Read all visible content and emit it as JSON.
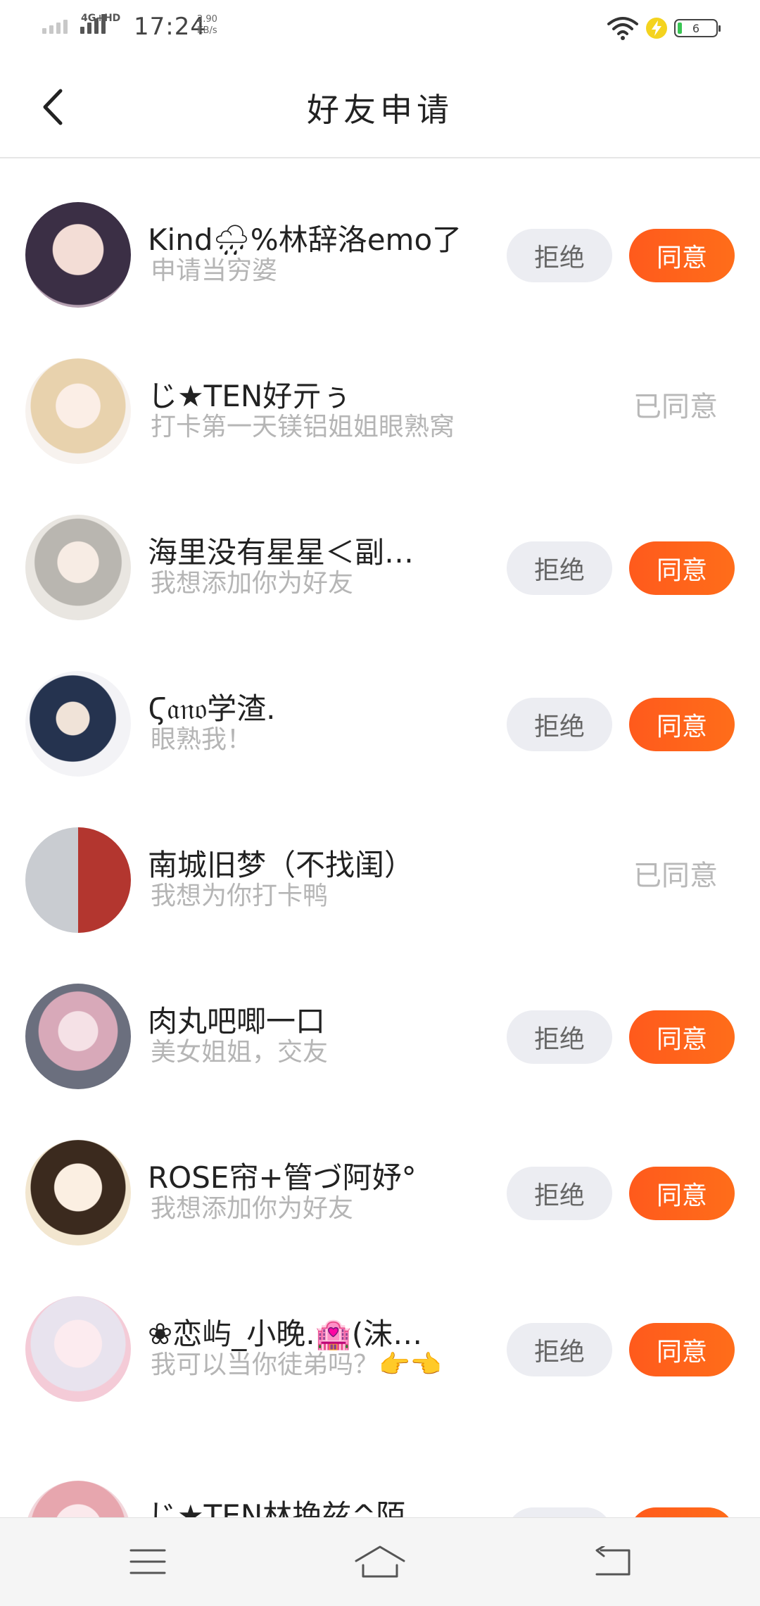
{
  "status_bar": {
    "network": "4G+HD",
    "time": "17:24",
    "speed_value": "2.90",
    "speed_unit": "KB/s",
    "battery_level": "6"
  },
  "header": {
    "title": "好友申请"
  },
  "buttons": {
    "reject": "拒绝",
    "agree": "同意"
  },
  "requests": [
    {
      "name": "Kind🌧%林辞洛emo了",
      "message": "申请当穷婆",
      "status": "pending"
    },
    {
      "name": "じ★TEN好亓ぅ",
      "message": "打卡第一天镁铝姐姐眼熟窝",
      "status": "agreed",
      "status_label": "已同意"
    },
    {
      "name": "海里没有星星＜副…",
      "message": "我想添加你为好友",
      "status": "pending"
    },
    {
      "name": "Ϛ𝔞𝔫𝔬学渣.",
      "message": "眼熟我！",
      "status": "pending"
    },
    {
      "name": "南城旧梦（不找闺）",
      "message": "我想为你打卡鸭",
      "status": "agreed",
      "status_label": "已同意"
    },
    {
      "name": "肉丸吧唧一口",
      "message": "美女姐姐，交友",
      "status": "pending"
    },
    {
      "name": "ROSE帘+管づ阿妤°",
      "message": "我想添加你为好友",
      "status": "pending"
    },
    {
      "name": "❀恋屿_小晚.🏩(沫…",
      "message": "我可以当你徒弟吗？👉👈",
      "status": "pending"
    },
    {
      "name": "じ★TEN林挽兹^陌",
      "message": "",
      "status": "pending"
    }
  ],
  "colors": {
    "accent": "#ff5a1c",
    "reject_bg": "#ecedf2",
    "muted_text": "#b5b5b5"
  },
  "nav_icons": [
    "menu-icon",
    "home-icon",
    "back-return-icon"
  ]
}
